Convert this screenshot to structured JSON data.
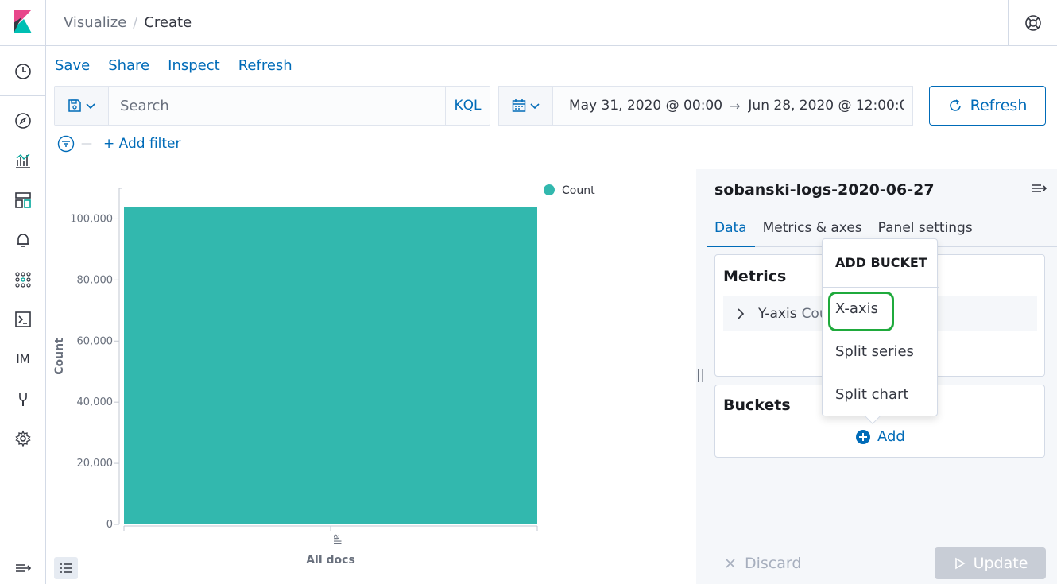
{
  "header": {
    "breadcrumbs": [
      "Visualize",
      "Create"
    ],
    "help_icon": "help-icon"
  },
  "nav": {
    "icons": [
      "clock-icon",
      "compass-icon",
      "visualize-icon",
      "dashboard-icon",
      "bell-icon",
      "apps-icon",
      "console-icon",
      "im-avatar",
      "wrench-icon",
      "gear-icon"
    ],
    "im_label": "IM",
    "bottom_icon": "menu-expand-icon"
  },
  "topmenu": {
    "save": "Save",
    "share": "Share",
    "inspect": "Inspect",
    "refresh": "Refresh"
  },
  "query": {
    "placeholder": "Search",
    "language": "KQL"
  },
  "time": {
    "start": "May 31, 2020 @ 00:00:",
    "arrow": "→",
    "end": "Jun 28, 2020 @ 12:00:0",
    "refresh_label": "Refresh"
  },
  "filters": {
    "add_label": "+ Add filter"
  },
  "chart_data": {
    "type": "bar",
    "categories": [
      "all"
    ],
    "values": [
      104000
    ],
    "xlabel": "All docs",
    "ylabel": "Count",
    "ylim": [
      0,
      110000
    ],
    "yticks": [
      0,
      20000,
      40000,
      60000,
      80000,
      100000
    ],
    "ytick_labels": [
      "0",
      "20,000",
      "40,000",
      "60,000",
      "80,000",
      "100,000"
    ],
    "legend": [
      {
        "name": "Count",
        "color": "#32b8ae"
      }
    ],
    "legend_position": "top-right",
    "color": "#32b8ae"
  },
  "panel": {
    "title": "sobanski-logs-2020-06-27",
    "tabs": [
      "Data",
      "Metrics & axes",
      "Panel settings"
    ],
    "metrics": {
      "title": "Metrics",
      "row_label": "Y-axis",
      "row_sub": "Cou"
    },
    "buckets": {
      "title": "Buckets",
      "add_label": "Add"
    },
    "discard_label": "Discard",
    "update_label": "Update"
  },
  "popover": {
    "title": "ADD BUCKET",
    "items": [
      "X-axis",
      "Split series",
      "Split chart"
    ]
  }
}
